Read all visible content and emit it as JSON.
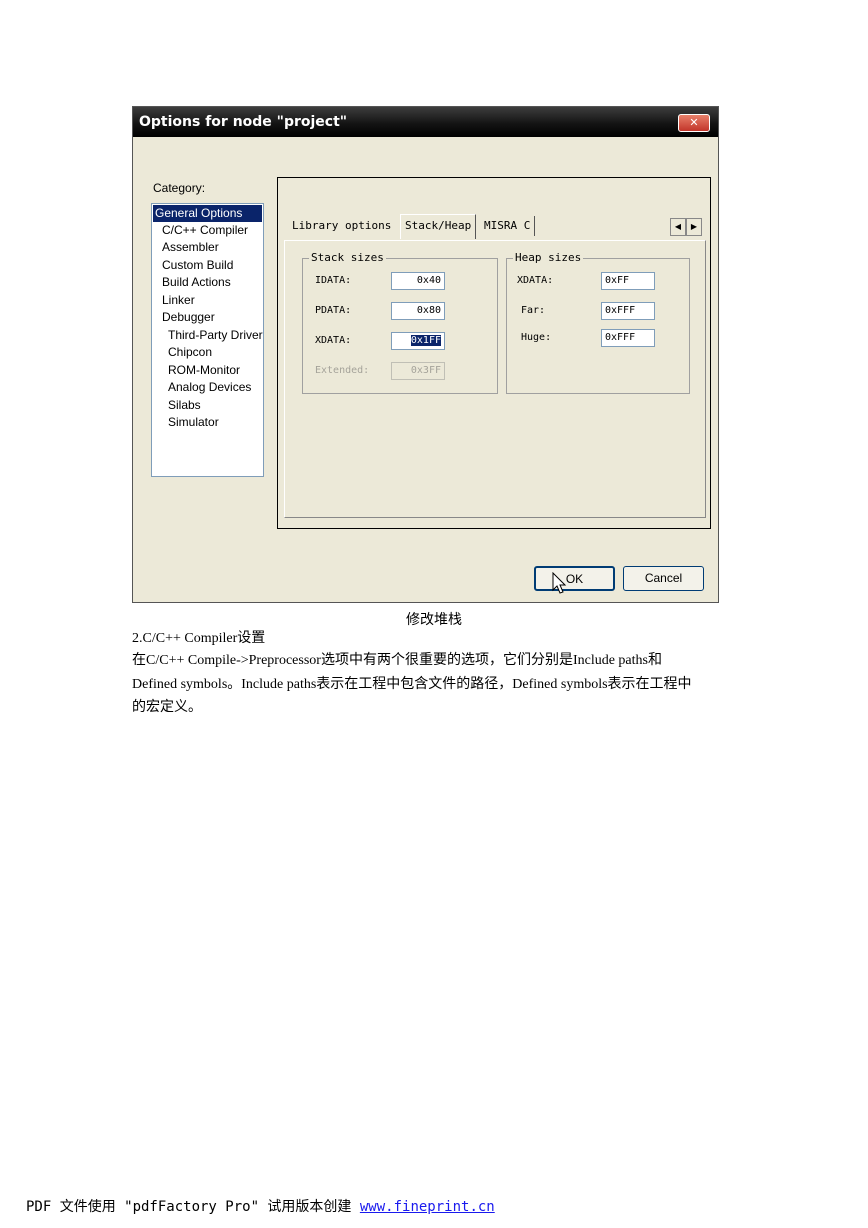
{
  "dialog": {
    "title": "Options for node \"project\"",
    "close_label": "✕",
    "category_label": "Category:",
    "categories": [
      "General Options",
      "C/C++ Compiler",
      "Assembler",
      "Custom Build",
      "Build Actions",
      "Linker",
      "Debugger",
      "Third-Party Driver",
      "Chipcon",
      "ROM-Monitor",
      "Analog Devices",
      "Silabs",
      "Simulator"
    ],
    "selected_category": "General Options",
    "tabs": [
      "Library options",
      "Stack/Heap",
      "MISRA C"
    ],
    "active_tab": "Stack/Heap",
    "stack": {
      "title": "Stack sizes",
      "idata_label": "IDATA:",
      "idata_value": "0x40",
      "pdata_label": "PDATA:",
      "pdata_value": "0x80",
      "xdata_label": "XDATA:",
      "xdata_value": "0x1FF",
      "extended_label": "Extended:",
      "extended_value": "0x3FF"
    },
    "heap": {
      "title": "Heap sizes",
      "xdata_label": "XDATA:",
      "xdata_value": "0xFF",
      "far_label": "Far:",
      "far_value": "0xFFF",
      "huge_label": "Huge:",
      "huge_value": "0xFFF"
    },
    "ok_label": "OK",
    "cancel_label": "Cancel"
  },
  "document": {
    "caption": "修改堆栈",
    "heading": "2.C/C++ Compiler设置",
    "paragraph_line1": "在C/C++  Compile->Preprocessor选项中有两个很重要的选项，它们分别是Include  paths和",
    "paragraph_line2": "Defined symbols。Include paths表示在工程中包含文件的路径，Defined symbols表示在工程中",
    "paragraph_line3": "的宏定义。"
  },
  "footer": {
    "prefix": "PDF 文件使用 \"pdfFactory Pro\" 试用版本创建 ",
    "link": "www.fineprint.cn"
  }
}
